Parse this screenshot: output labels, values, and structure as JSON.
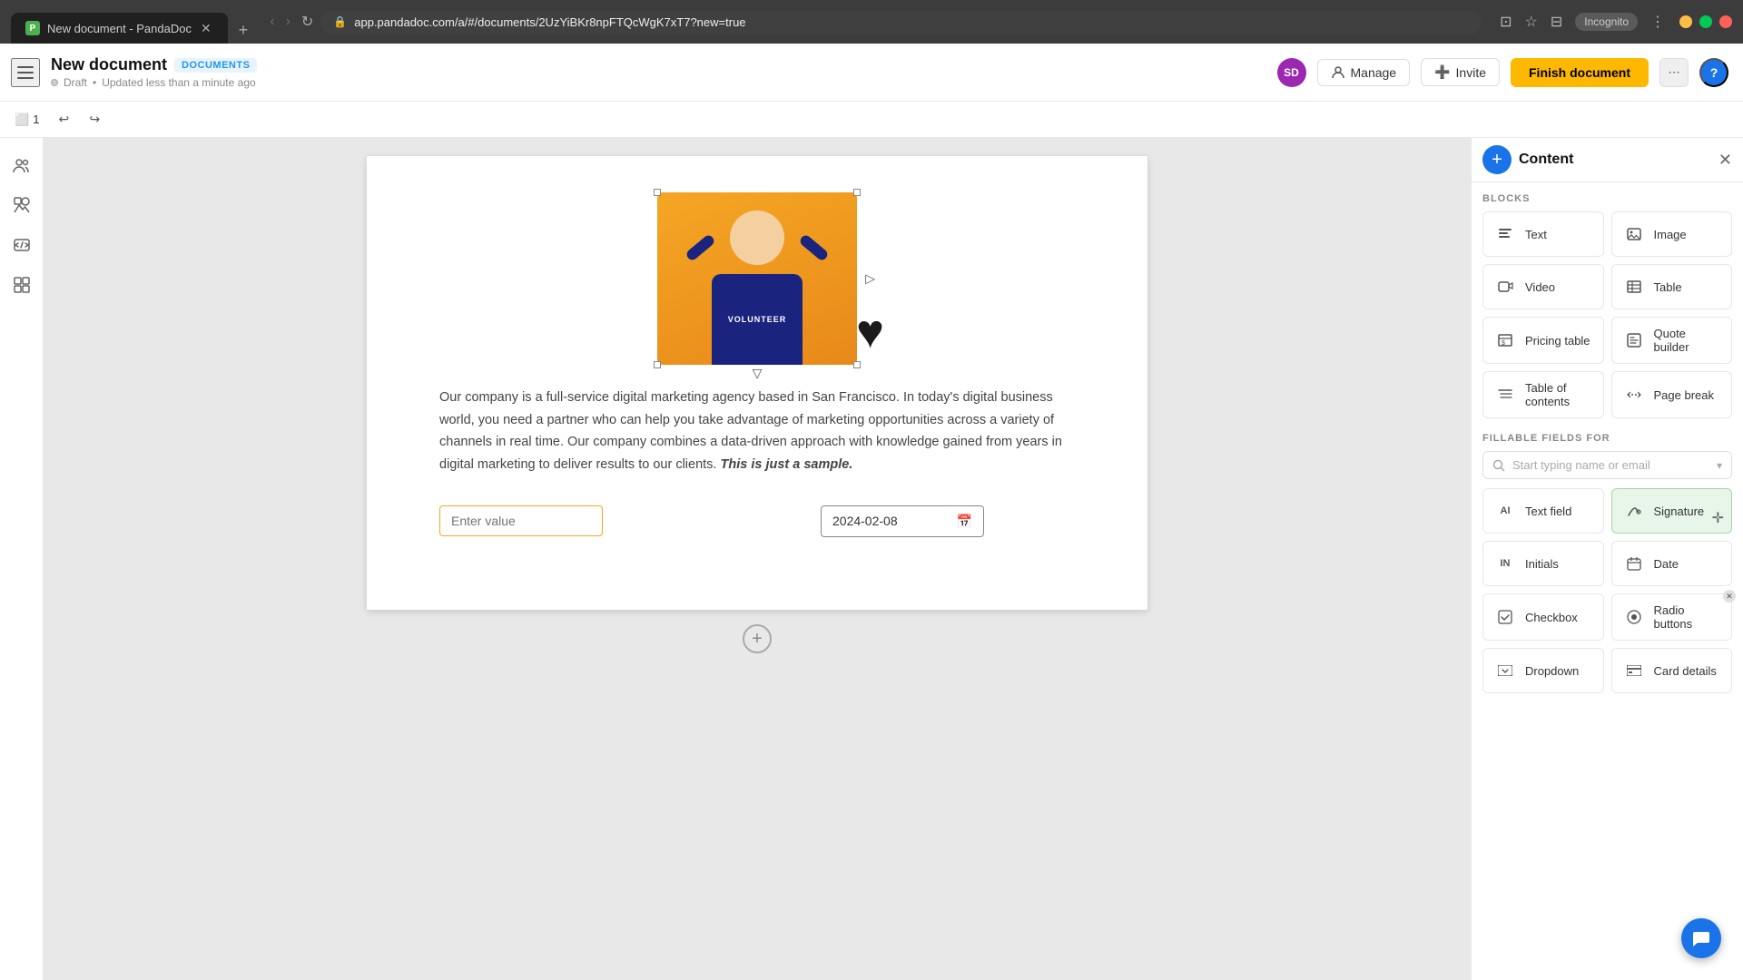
{
  "browser": {
    "tab_title": "New document - PandaDoc",
    "url": "app.pandadoc.com/a/#/documents/2UzYiBKr8npFTQcWgK7xT7?new=true",
    "new_tab_label": "+",
    "incognito_label": "Incognito"
  },
  "header": {
    "menu_icon": "☰",
    "doc_title": "New document",
    "doc_badge": "DOCUMENTS",
    "doc_status": "Draft",
    "doc_meta": "Updated less than a minute ago",
    "sd_avatar": "SD",
    "manage_label": "Manage",
    "invite_label": "Invite",
    "finish_label": "Finish document",
    "more_icon": "⋯",
    "help_icon": "?"
  },
  "toolbar": {
    "page_icon": "⬜",
    "page_count": "1",
    "undo_icon": "↩",
    "redo_icon": "↪"
  },
  "left_sidebar": {
    "icons": [
      {
        "name": "users-icon",
        "symbol": "👥"
      },
      {
        "name": "shapes-icon",
        "symbol": "◈"
      },
      {
        "name": "code-icon",
        "symbol": "⌨"
      },
      {
        "name": "grid-icon",
        "symbol": "⣿"
      }
    ]
  },
  "document": {
    "text_content": "Our company is a full-service digital marketing agency based in San Francisco. In today's digital business world, you need a partner who can help you take advantage of marketing opportunities across a variety of channels in real time. Our company combines a data-driven approach with knowledge gained from years in digital marketing to deliver results to our clients.",
    "text_italic": "This is just a sample.",
    "text_field_placeholder": "Enter value",
    "date_field_value": "2024-02-08",
    "add_block_icon": "+"
  },
  "right_panel": {
    "title": "Content",
    "close_icon": "✕",
    "add_icon": "+",
    "blocks_label": "BLOCKS",
    "blocks": [
      {
        "id": "text",
        "label": "Text",
        "icon": "T"
      },
      {
        "id": "image",
        "label": "Image",
        "icon": "🖼"
      },
      {
        "id": "video",
        "label": "Video",
        "icon": "▶"
      },
      {
        "id": "table",
        "label": "Table",
        "icon": "⊞"
      },
      {
        "id": "pricing-table",
        "label": "Pricing table",
        "icon": "$≡"
      },
      {
        "id": "quote-builder",
        "label": "Quote builder",
        "icon": "📋"
      },
      {
        "id": "table-of-contents",
        "label": "Table of contents",
        "icon": "≡"
      },
      {
        "id": "page-break",
        "label": "Page break",
        "icon": "✂"
      }
    ],
    "fillable_label": "FILLABLE FIELDS FOR",
    "search_placeholder": "Start typing name or email",
    "fields": [
      {
        "id": "text-field",
        "label": "Text field",
        "icon": "AI"
      },
      {
        "id": "signature",
        "label": "Signature",
        "icon": "✒",
        "highlighted": true
      },
      {
        "id": "initials",
        "label": "Initials",
        "icon": "IN"
      },
      {
        "id": "date",
        "label": "Date",
        "icon": "📅"
      },
      {
        "id": "checkbox",
        "label": "Checkbox",
        "icon": "☑"
      },
      {
        "id": "radio-buttons",
        "label": "Radio buttons",
        "icon": "◉"
      },
      {
        "id": "dropdown",
        "label": "Dropdown",
        "icon": "▾"
      },
      {
        "id": "card-details",
        "label": "Card details",
        "icon": "💳"
      }
    ]
  }
}
